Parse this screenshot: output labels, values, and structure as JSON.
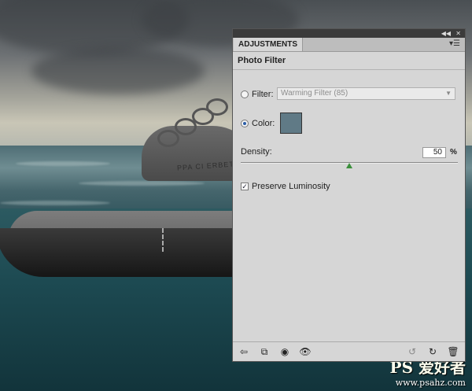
{
  "panel": {
    "tab_label": "ADJUSTMENTS",
    "title": "Photo Filter",
    "filter_label": "Filter:",
    "filter_value": "Warming Filter (85)",
    "color_label": "Color:",
    "color_swatch": "#607a86",
    "density_label": "Density:",
    "density_value": "50",
    "density_unit": "%",
    "density_fraction": 0.5,
    "preserve_label": "Preserve Luminosity",
    "preserve_checked": true,
    "filter_selected": false,
    "color_selected": true,
    "footer_icons": [
      "back-arrow-icon",
      "clip-layer-icon",
      "visibility-toggle-icon",
      "eye-icon",
      "previous-state-icon",
      "reset-icon",
      "trash-icon"
    ]
  },
  "scene": {
    "shoe_print": "PPA CI ERBET"
  },
  "watermark": {
    "brand": "PS 爱好者",
    "url": "www.psahz.com"
  }
}
